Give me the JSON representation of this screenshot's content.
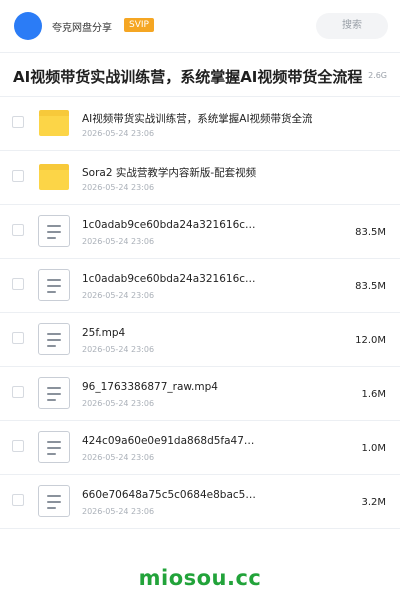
{
  "header": {
    "username": "夸克网盘分享",
    "badge": "SVIP",
    "search_label": "搜索"
  },
  "folder": {
    "title": "AI视频带货实战训练营，系统掌握AI视频带货全流程",
    "total_size": "2.6G"
  },
  "items": [
    {
      "type": "folder",
      "name": "AI视频带货实战训练营，系统掌握AI视频带货全流程",
      "date": "2026-05-24 23:06",
      "size": ""
    },
    {
      "type": "folder",
      "name": "Sora2 实战营教学内容新版-配套视频",
      "date": "2026-05-24 23:06",
      "size": ""
    },
    {
      "type": "file",
      "name": "1c0adab9ce60bda24a321616c…",
      "date": "2026-05-24 23:06",
      "size": "83.5M"
    },
    {
      "type": "file",
      "name": "1c0adab9ce60bda24a321616c…",
      "date": "2026-05-24 23:06",
      "size": "83.5M"
    },
    {
      "type": "file",
      "name": "25f.mp4",
      "date": "2026-05-24 23:06",
      "size": "12.0M"
    },
    {
      "type": "file",
      "name": "96_1763386877_raw.mp4",
      "date": "2026-05-24 23:06",
      "size": "1.6M"
    },
    {
      "type": "file",
      "name": "424c09a60e0e91da868d5fa47…",
      "date": "2026-05-24 23:06",
      "size": "1.0M"
    },
    {
      "type": "file",
      "name": "660e70648a75c5c0684e8bac5…",
      "date": "2026-05-24 23:06",
      "size": "3.2M"
    }
  ],
  "watermark": "miosou.cc"
}
